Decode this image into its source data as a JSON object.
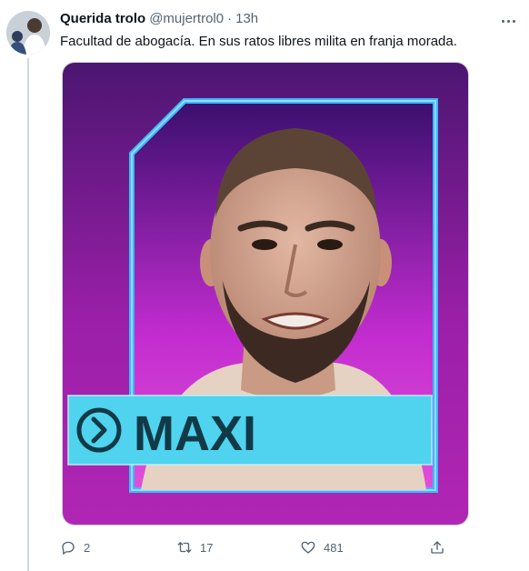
{
  "tweet": {
    "author_name": "Querida trolo",
    "author_handle": "@mujertrol0",
    "separator": "·",
    "timestamp": "13h",
    "text": "Facultad de abogacía. En sus ratos libres milita en franja morada."
  },
  "media": {
    "name_card_label": "MAXI",
    "colors": {
      "background_top": "#5a1a7a",
      "background_bottom": "#c020b0",
      "frame": "#3fb6ff",
      "name_bar": "#4fd3ef",
      "name_text": "#123a46"
    }
  },
  "actions": {
    "reply_count": "2",
    "retweet_count": "17",
    "like_count": "481",
    "share_icon": "share-icon"
  }
}
